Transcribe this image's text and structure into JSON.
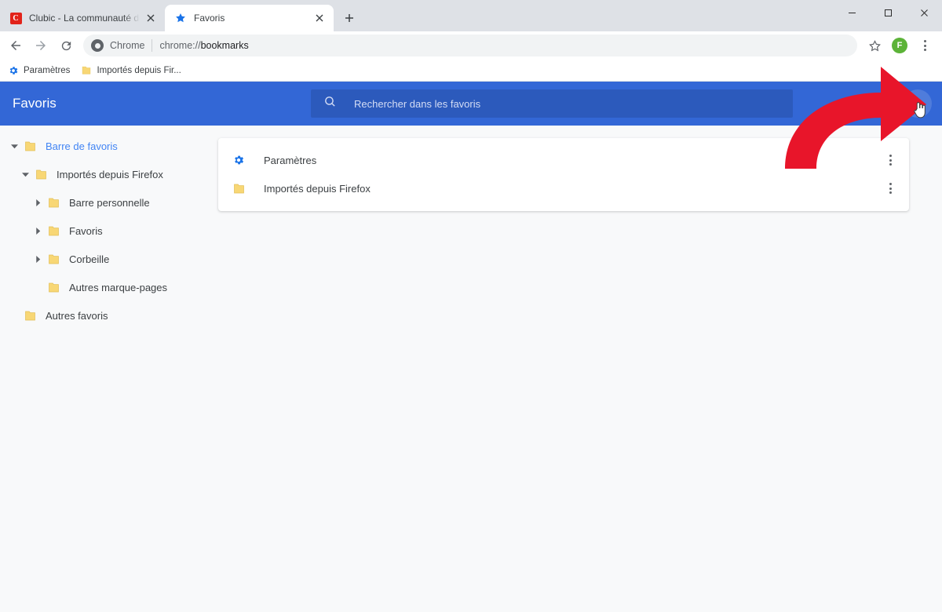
{
  "window": {
    "controls": {
      "minimize": "minimize-window",
      "maximize": "maximize-window",
      "close": "close-window"
    }
  },
  "tabs": [
    {
      "title": "Clubic - La communauté des pas",
      "favicon": "clubic-logo",
      "active": false,
      "close_label": "close-tab"
    },
    {
      "title": "Favoris",
      "favicon": "star-icon",
      "active": true,
      "close_label": "close-tab"
    }
  ],
  "new_tab_label": "+",
  "toolbar": {
    "back": "back-arrow",
    "forward": "forward-arrow",
    "reload": "reload-icon",
    "omnibox": {
      "scheme_label": "Chrome",
      "url_prefix": "chrome://",
      "url_bold": "bookmarks",
      "full_url": "chrome://bookmarks"
    },
    "bookmark_star": "star-outline-icon",
    "avatar_letter": "F",
    "menu": "chrome-menu-icon"
  },
  "bookmarks_bar": [
    {
      "label": "Paramètres",
      "icon": "gear-icon"
    },
    {
      "label": "Importés depuis Fir...",
      "icon": "folder-icon"
    }
  ],
  "app": {
    "title": "Favoris",
    "search": {
      "placeholder": "Rechercher dans les favoris",
      "value": ""
    },
    "header_menu": "more-options-icon",
    "sidebar": [
      {
        "label": "Barre de favoris",
        "depth": 0,
        "expanded": true,
        "has_children": true,
        "selected": true
      },
      {
        "label": "Importés depuis Firefox",
        "depth": 1,
        "expanded": true,
        "has_children": true,
        "selected": false
      },
      {
        "label": "Barre personnelle",
        "depth": 2,
        "expanded": false,
        "has_children": true,
        "selected": false
      },
      {
        "label": "Favoris",
        "depth": 2,
        "expanded": false,
        "has_children": true,
        "selected": false
      },
      {
        "label": "Corbeille",
        "depth": 2,
        "expanded": false,
        "has_children": true,
        "selected": false
      },
      {
        "label": "Autres marque-pages",
        "depth": 2,
        "expanded": false,
        "has_children": false,
        "selected": false
      },
      {
        "label": "Autres favoris",
        "depth": 0,
        "expanded": false,
        "has_children": false,
        "selected": false
      }
    ],
    "rows": [
      {
        "label": "Paramètres",
        "icon": "gear-icon",
        "menu": "row-more-options-icon"
      },
      {
        "label": "Importés depuis Firefox",
        "icon": "folder-icon",
        "menu": "row-more-options-icon"
      }
    ]
  },
  "annotation": {
    "arrow_color": "#e8152a",
    "arrow_target": "header-more-options-button",
    "cursor": "pointer-hand-cursor"
  },
  "colors": {
    "header_blue": "#3367d6",
    "tabstrip_gray": "#dee1e6",
    "app_background": "#f8f9fa",
    "accent_blue": "#4285f4",
    "folder_yellow": "#f8d775",
    "avatar_green": "#5cb338",
    "clubic_red": "#e2231a"
  }
}
